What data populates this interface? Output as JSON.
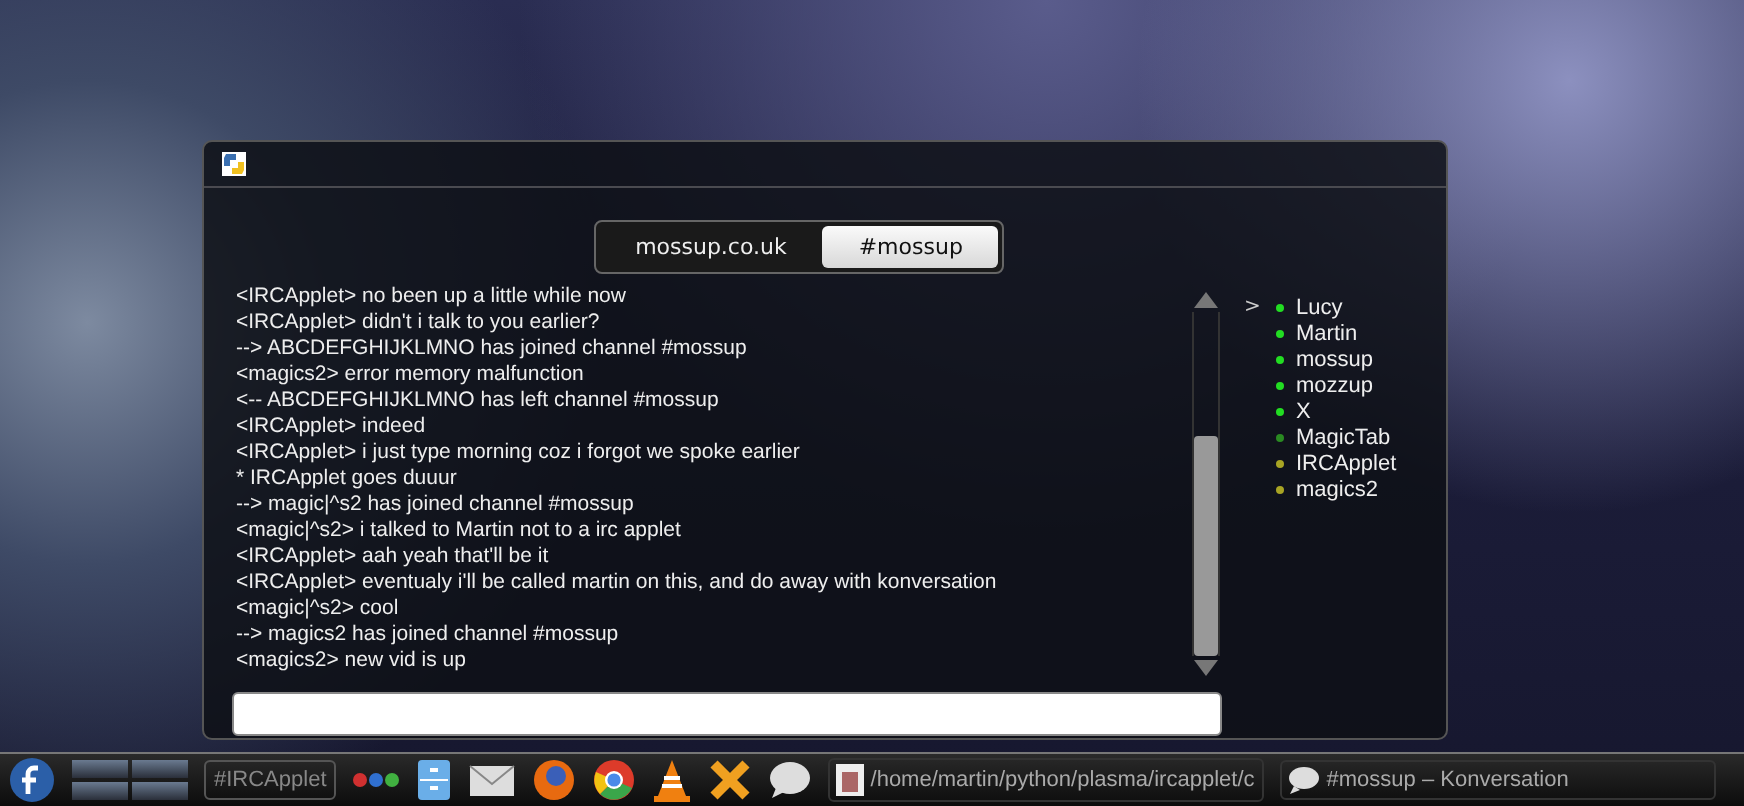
{
  "channel_tabs": [
    {
      "label": "mossup.co.uk",
      "selected": false
    },
    {
      "label": "#mossup",
      "selected": true
    }
  ],
  "chat_lines": [
    "<IRCApplet> no been up a little while now",
    "<IRCApplet> didn't i talk to you earlier?",
    "--> ABCDEFGHIJKLMNO has joined channel #mossup",
    "<magics2> error memory malfunction",
    "<-- ABCDEFGHIJKLMNO has left channel #mossup",
    "<IRCApplet> indeed",
    "<IRCApplet> i just type morning coz i forgot we spoke earlier",
    "* IRCApplet goes duuur",
    "--> magic|^s2 has joined channel #mossup",
    "<magic|^s2> i talked to Martin not to a irc applet",
    "<IRCApplet> aah yeah that'll be it",
    "<IRCApplet> eventualy i'll be called martin on this, and do away with konversation",
    "<magic|^s2> cool",
    "--> magics2 has joined channel #mossup",
    "<magics2> new vid is up"
  ],
  "nick_marker": ">",
  "nicks": [
    {
      "name": "Lucy",
      "color": "#22dd22"
    },
    {
      "name": "Martin",
      "color": "#22dd22"
    },
    {
      "name": "mossup",
      "color": "#22dd22"
    },
    {
      "name": "mozzup",
      "color": "#22dd22"
    },
    {
      "name": "X",
      "color": "#22dd22"
    },
    {
      "name": "MagicTab",
      "color": "#2a8a22"
    },
    {
      "name": "IRCApplet",
      "color": "#a8a424"
    },
    {
      "name": "magics2",
      "color": "#a8a424"
    }
  ],
  "taskbar": {
    "applet_button": "#IRCApplet",
    "tasks": [
      {
        "label": "/home/martin/python/plasma/ircapplet/c",
        "kind": "folder"
      },
      {
        "label": "#mossup – Konversation",
        "kind": "chat"
      }
    ]
  }
}
